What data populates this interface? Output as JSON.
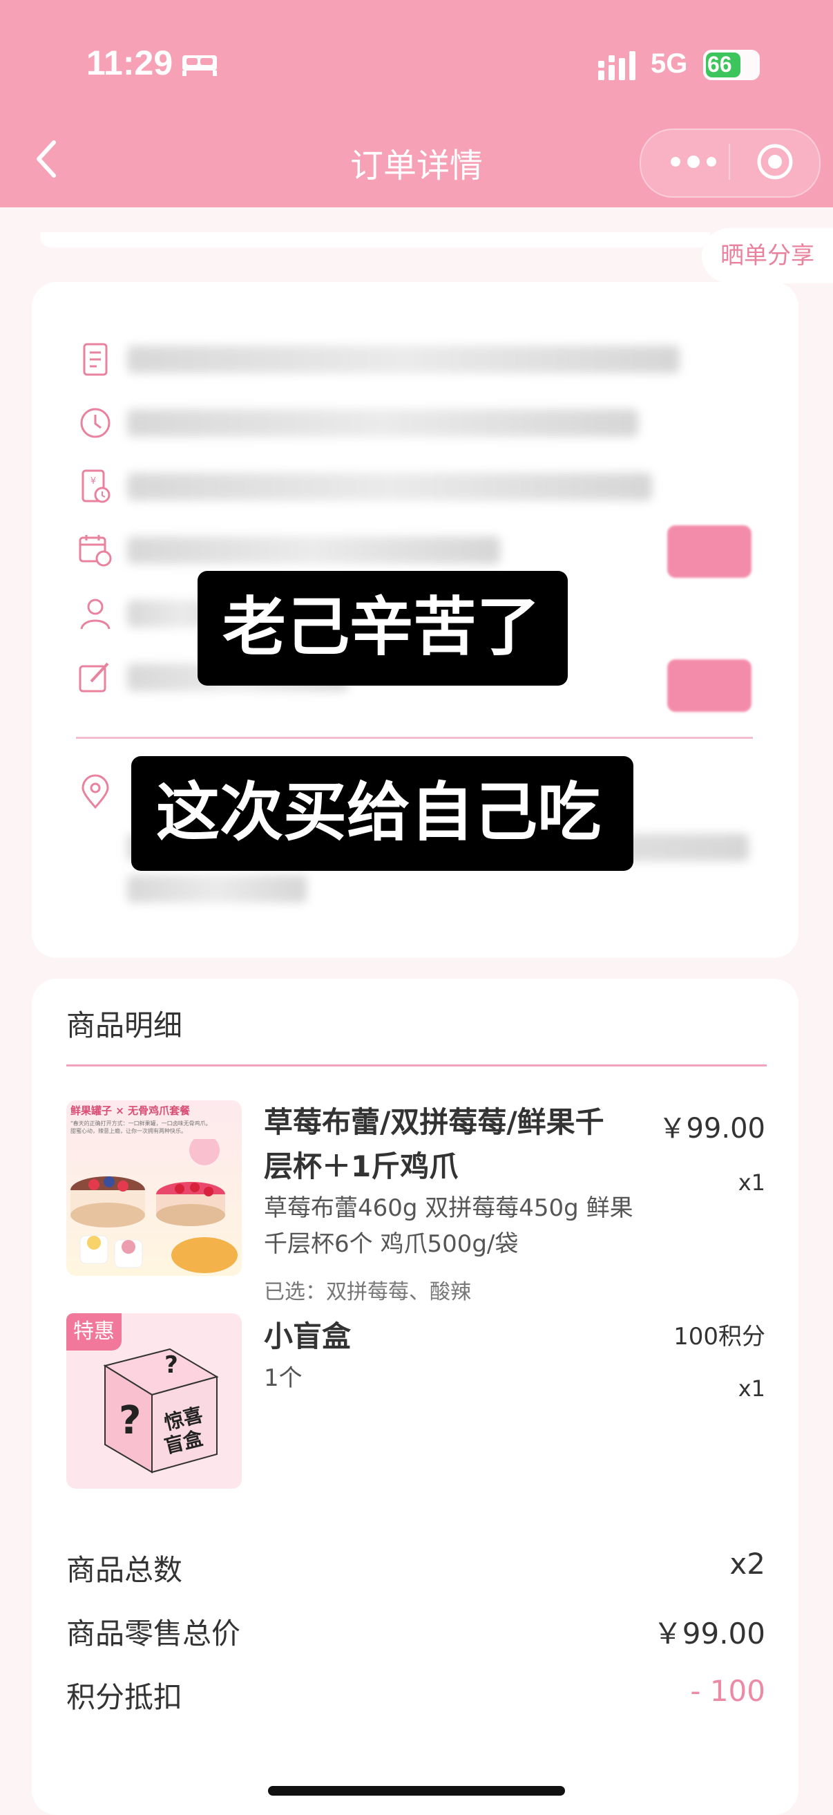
{
  "status_bar": {
    "time": "11:29",
    "network": "5G",
    "battery": "66"
  },
  "nav": {
    "title": "订单详情"
  },
  "share_button": "晒单分享",
  "overlays": {
    "line1": "老己辛苦了",
    "line2": "这次买给自己吃"
  },
  "goods_section": {
    "title": "商品明细",
    "items": [
      {
        "name_line1": "草莓布蕾/双拼莓莓/鲜果千",
        "name_line2": "层杯＋1斤鸡爪",
        "spec_line1": "草莓布蕾460g 双拼莓莓450g 鲜果",
        "spec_line2": "千层杯6个 鸡爪500g/袋",
        "selected": "已选：双拼莓莓、酸辣",
        "price": "￥99.00",
        "qty": "x1",
        "image": {
          "banner_left": "鲜果罐子",
          "banner_x": "×",
          "banner_right": "无骨鸡爪套餐",
          "caption1": "\"春天的正确打开方式：一口鲜果罐，一口卤味无骨鸡爪。",
          "caption2": "甜蜜心动，辣意上瘾，让你一次拥有两种快乐。"
        }
      },
      {
        "tag": "特惠",
        "name_line1": "小盲盒",
        "spec_line1": "1个",
        "price": "100积分",
        "qty": "x1",
        "image": {
          "box_text1": "惊喜",
          "box_text2": "盲盒",
          "q1": "?",
          "q2": "?"
        }
      }
    ]
  },
  "summary": [
    {
      "label": "商品总数",
      "value": "x2"
    },
    {
      "label": "商品零售总价",
      "value": "￥99.00"
    },
    {
      "label": "积分抵扣",
      "value": "- 100"
    }
  ],
  "colors": {
    "brand_pink": "#f7a1b7",
    "accent_pink": "#e8829e",
    "battery_green": "#34c759"
  }
}
